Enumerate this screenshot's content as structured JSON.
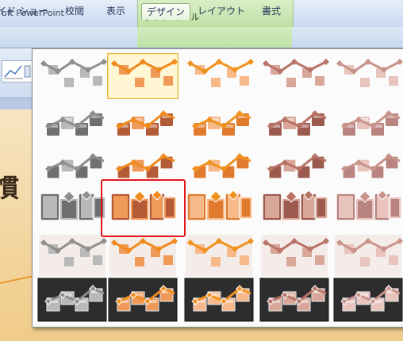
{
  "app": {
    "title": "oft PowerPoint"
  },
  "context_group": {
    "title": "グラフ ツール"
  },
  "tabs": [
    {
      "label": "イド ショー"
    },
    {
      "label": "校閲"
    },
    {
      "label": "表示"
    },
    {
      "label": "デザイン"
    },
    {
      "label": "レイアウト"
    },
    {
      "label": "書式"
    }
  ],
  "slide": {
    "heading": "慣"
  },
  "gallery": {
    "rows": [
      {
        "style": "marker"
      },
      {
        "style": "raised"
      },
      {
        "style": "flat-outline"
      },
      {
        "style": "bevel"
      },
      {
        "style": "light"
      },
      {
        "style": "dark-background"
      }
    ],
    "columns": [
      {
        "color": "gray",
        "main": "#6f6f6f",
        "light": "#b9b9b9",
        "accent": "#8e8e8e"
      },
      {
        "color": "orange",
        "main": "#b35a36",
        "light": "#f09a5a",
        "accent": "#f08a1c"
      },
      {
        "color": "peach",
        "main": "#e07a2c",
        "light": "#f7b98a",
        "accent": "#f0921f"
      },
      {
        "color": "brown",
        "main": "#9c5a4e",
        "light": "#d9a79a",
        "accent": "#b97266"
      },
      {
        "color": "pink",
        "main": "#b98480",
        "light": "#e8c4bd",
        "accent": "#c9938b"
      }
    ],
    "hover": {
      "row": 0,
      "col": 1
    },
    "selected": {
      "row": 3,
      "col": 1
    }
  }
}
